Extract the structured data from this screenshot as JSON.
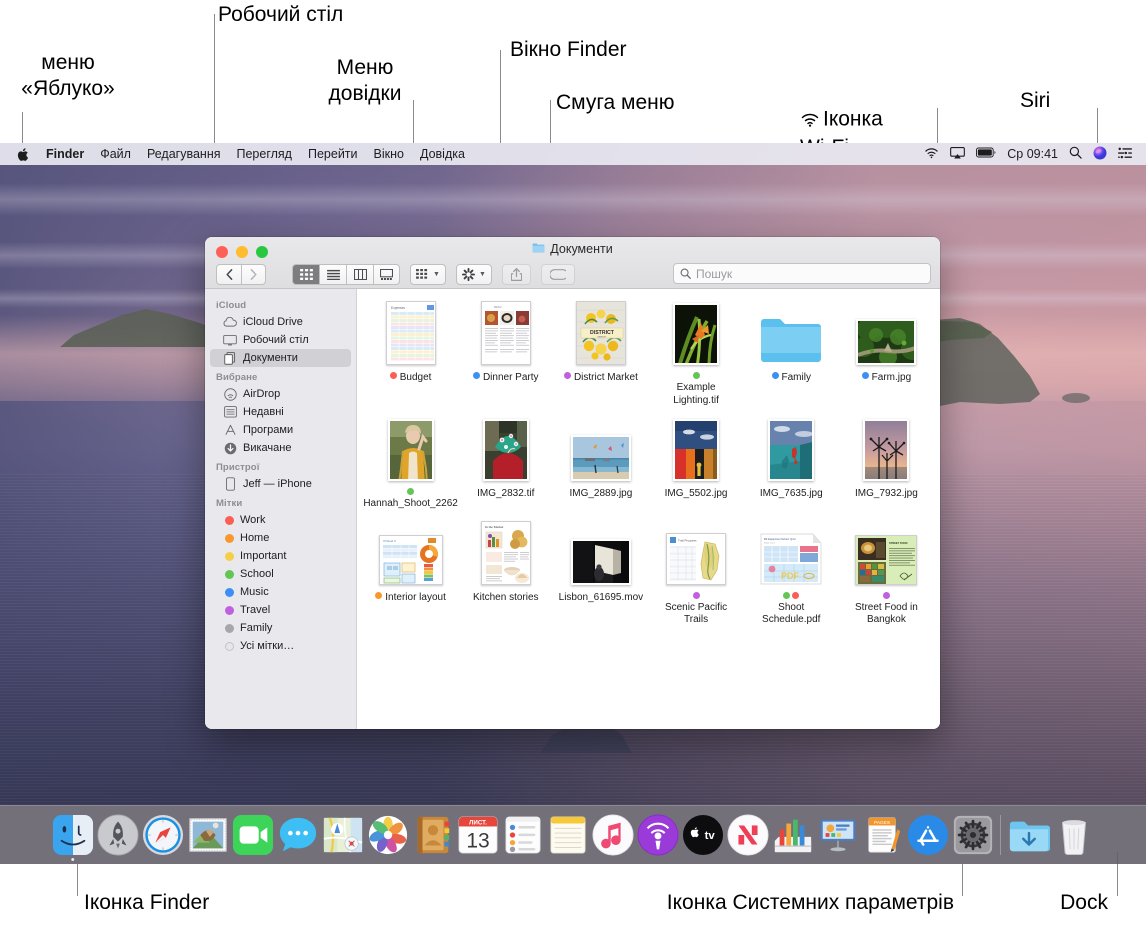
{
  "annotations": {
    "apple_menu": "меню\n«Яблуко»",
    "desktop": "Робочий стіл",
    "help_menu": "Меню\nдовідки",
    "finder_window": "Вікно Finder",
    "menu_bar": "Смуга меню",
    "wifi_icon": "Іконка\nWi-Fi",
    "siri": "Siri",
    "finder_icon": "Іконка Finder",
    "system_prefs_icon": "Іконка Системних параметрів",
    "dock": "Dock"
  },
  "menubar": {
    "apple_icon": "apple-logo-icon",
    "items": [
      {
        "label": "Finder",
        "bold": true
      },
      {
        "label": "Файл",
        "bold": false
      },
      {
        "label": "Редагування",
        "bold": false
      },
      {
        "label": "Перегляд",
        "bold": false
      },
      {
        "label": "Перейти",
        "bold": false
      },
      {
        "label": "Вікно",
        "bold": false
      },
      {
        "label": "Довідка",
        "bold": false
      }
    ],
    "status": {
      "wifi": "wifi-icon",
      "airplay": "airplay-icon",
      "battery": "battery-icon",
      "clock": "Ср 09:41",
      "search": "spotlight-search-icon",
      "siri": "siri-icon",
      "control_center": "control-center-icon"
    }
  },
  "finder": {
    "title": "Документи",
    "title_icon": "folder-icon",
    "nav": {
      "back": "chevron-left-icon",
      "forward": "chevron-right-icon"
    },
    "view_buttons": [
      {
        "name": "icon-view",
        "selected": true
      },
      {
        "name": "list-view",
        "selected": false
      },
      {
        "name": "column-view",
        "selected": false
      },
      {
        "name": "gallery-view",
        "selected": false
      }
    ],
    "toolbar_extra": [
      {
        "name": "group-by-button"
      },
      {
        "name": "action-gear-button"
      },
      {
        "name": "share-button"
      },
      {
        "name": "tag-button"
      }
    ],
    "search": {
      "placeholder": "Пошук",
      "value": ""
    },
    "sidebar": [
      {
        "header": "iCloud",
        "items": [
          {
            "label": "iCloud Drive",
            "icon": "cloud-icon",
            "active": false
          },
          {
            "label": "Робочий стіл",
            "icon": "desktop-icon",
            "active": false
          },
          {
            "label": "Документи",
            "icon": "documents-icon",
            "active": true
          }
        ]
      },
      {
        "header": "Вибране",
        "items": [
          {
            "label": "AirDrop",
            "icon": "airdrop-icon",
            "active": false
          },
          {
            "label": "Недавні",
            "icon": "recents-icon",
            "active": false
          },
          {
            "label": "Програми",
            "icon": "applications-icon",
            "active": false
          },
          {
            "label": "Викачане",
            "icon": "downloads-icon",
            "active": false
          }
        ]
      },
      {
        "header": "Пристрої",
        "items": [
          {
            "label": "Jeff — iPhone",
            "icon": "iphone-icon",
            "active": false
          }
        ]
      },
      {
        "header": "Мітки",
        "items": [
          {
            "label": "Work",
            "icon": "tag-dot",
            "color": "#fc5d55",
            "active": false
          },
          {
            "label": "Home",
            "icon": "tag-dot",
            "color": "#f8982c",
            "active": false
          },
          {
            "label": "Important",
            "icon": "tag-dot",
            "color": "#f6ce46",
            "active": false
          },
          {
            "label": "School",
            "icon": "tag-dot",
            "color": "#62c554",
            "active": false
          },
          {
            "label": "Music",
            "icon": "tag-dot",
            "color": "#3d8ff4",
            "active": false
          },
          {
            "label": "Travel",
            "icon": "tag-dot",
            "color": "#c160de",
            "active": false
          },
          {
            "label": "Family",
            "icon": "tag-dot",
            "color": "#a6a6ab",
            "active": false
          },
          {
            "label": "Усі мітки…",
            "icon": "tag-dot-outline",
            "color": "#d6d6da",
            "active": false
          }
        ]
      }
    ],
    "files": [
      {
        "name": "Budget",
        "kind": "spreadsheet",
        "tags": [
          "#fc5d55"
        ]
      },
      {
        "name": "Dinner Party",
        "kind": "magazine",
        "tags": [
          "#3d8ff4"
        ]
      },
      {
        "name": "District Market",
        "kind": "poster",
        "tags": [
          "#c160de"
        ]
      },
      {
        "name": "Example Lighting.tif",
        "kind": "photo-plant",
        "tags": [
          "#62c554"
        ]
      },
      {
        "name": "Family",
        "kind": "folder",
        "tags": [
          "#3d8ff4"
        ]
      },
      {
        "name": "Farm.jpg",
        "kind": "photo-farm",
        "tags": [
          "#3d8ff4"
        ]
      },
      {
        "name": "Hannah_Shoot_2262",
        "kind": "photo-portrait",
        "tags": [
          "#62c554"
        ]
      },
      {
        "name": "IMG_2832.tif",
        "kind": "photo-hat",
        "tags": []
      },
      {
        "name": "IMG_2889.jpg",
        "kind": "photo-beach",
        "tags": []
      },
      {
        "name": "IMG_5502.jpg",
        "kind": "photo-colorwall",
        "tags": []
      },
      {
        "name": "IMG_7635.jpg",
        "kind": "photo-teal",
        "tags": []
      },
      {
        "name": "IMG_7932.jpg",
        "kind": "photo-palms",
        "tags": []
      },
      {
        "name": "Interior layout",
        "kind": "keynote-chart",
        "tags": [
          "#f8982c"
        ]
      },
      {
        "name": "Kitchen stories",
        "kind": "recipe-page",
        "tags": []
      },
      {
        "name": "Lisbon_61695.mov",
        "kind": "movie-dark",
        "tags": []
      },
      {
        "name": "Scenic Pacific Trails",
        "kind": "map-doc",
        "tags": [
          "#c160de"
        ]
      },
      {
        "name": "Shoot Schedule.pdf",
        "kind": "pdf-doc",
        "tags": [
          "#62c554",
          "#fc5d55"
        ]
      },
      {
        "name": "Street Food in Bangkok",
        "kind": "green-page",
        "tags": [
          "#c160de"
        ]
      }
    ]
  },
  "dock": {
    "items": [
      {
        "name": "finder",
        "icon": "finder-icon",
        "running": true
      },
      {
        "name": "launchpad",
        "icon": "launchpad-icon",
        "running": false
      },
      {
        "name": "safari",
        "icon": "safari-icon",
        "running": false
      },
      {
        "name": "mail",
        "icon": "mail-icon",
        "running": false
      },
      {
        "name": "facetime",
        "icon": "facetime-icon",
        "running": false
      },
      {
        "name": "messages",
        "icon": "messages-icon",
        "running": false
      },
      {
        "name": "maps",
        "icon": "maps-icon",
        "running": false
      },
      {
        "name": "photos",
        "icon": "photos-icon",
        "running": false
      },
      {
        "name": "contacts",
        "icon": "contacts-icon",
        "running": false
      },
      {
        "name": "calendar",
        "icon": "calendar-icon",
        "running": false
      },
      {
        "name": "reminders",
        "icon": "reminders-icon",
        "running": false
      },
      {
        "name": "notes",
        "icon": "notes-icon",
        "running": false
      },
      {
        "name": "music",
        "icon": "music-icon",
        "running": false
      },
      {
        "name": "podcasts",
        "icon": "podcasts-icon",
        "running": false
      },
      {
        "name": "apple-tv",
        "icon": "apple-tv-icon",
        "running": false
      },
      {
        "name": "news",
        "icon": "news-icon",
        "running": false
      },
      {
        "name": "numbers",
        "icon": "numbers-icon",
        "running": false
      },
      {
        "name": "keynote",
        "icon": "keynote-icon",
        "running": false
      },
      {
        "name": "pages",
        "icon": "pages-icon",
        "running": false
      },
      {
        "name": "app-store",
        "icon": "app-store-icon",
        "running": false
      },
      {
        "name": "system-preferences",
        "icon": "system-preferences-icon",
        "running": false
      },
      {
        "name": "downloads-folder",
        "icon": "downloads-folder-icon",
        "running": false
      },
      {
        "name": "trash",
        "icon": "trash-icon",
        "running": false
      }
    ],
    "calendar": {
      "month": "ЛИСТ.",
      "day": "13"
    }
  },
  "colors": {
    "tag_red": "#fc5d55",
    "tag_orange": "#f8982c",
    "tag_yellow": "#f6ce46",
    "tag_green": "#62c554",
    "tag_blue": "#3d8ff4",
    "tag_purple": "#c160de",
    "tag_gray": "#a6a6ab",
    "selection": "rgba(0,0,0,0.10)"
  }
}
